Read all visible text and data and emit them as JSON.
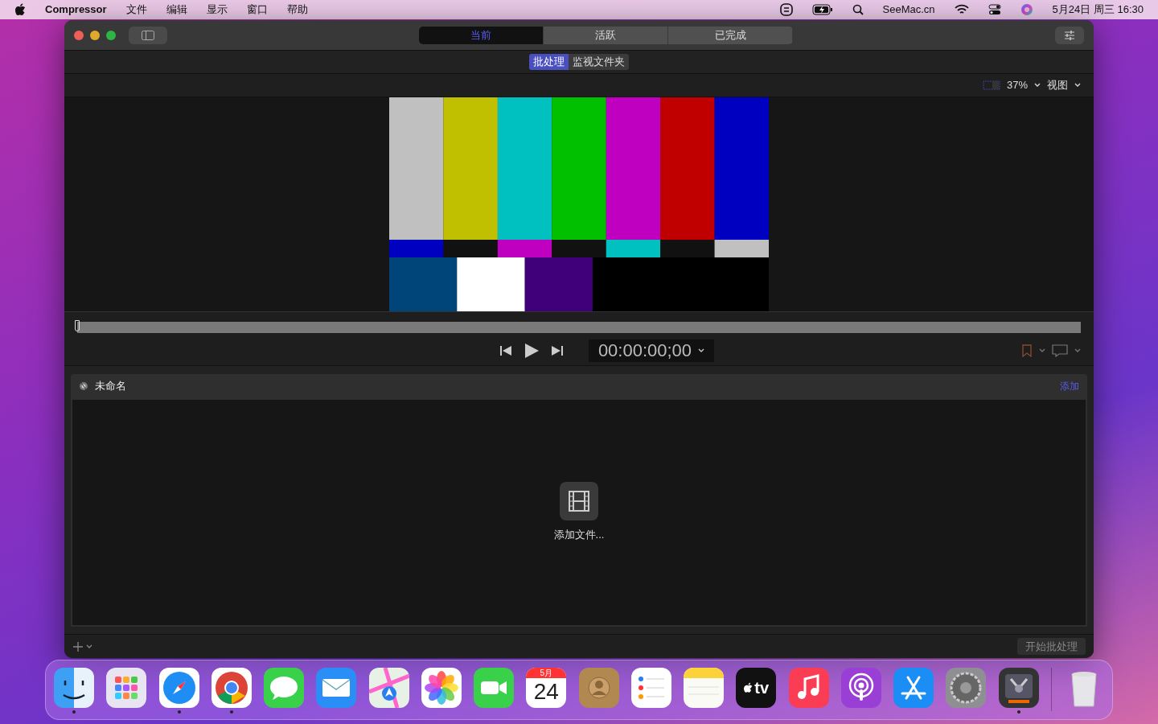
{
  "menubar": {
    "app_name": "Compressor",
    "menus": [
      "文件",
      "编辑",
      "显示",
      "窗口",
      "帮助"
    ],
    "status_text": "SeeMac.cn",
    "clock": "5月24日 周三 16:30"
  },
  "window": {
    "tabs": [
      {
        "label": "当前",
        "selected": true
      },
      {
        "label": "活跃",
        "selected": false
      },
      {
        "label": "已完成",
        "selected": false
      }
    ],
    "mode_tabs": [
      {
        "label": "批处理",
        "selected": true
      },
      {
        "label": "监视文件夹",
        "selected": false
      }
    ],
    "zoom": "37%",
    "view_menu": "视图",
    "timeline": {
      "level": 0
    },
    "timecode": "00:00:00;00",
    "batch": {
      "title": "未命名",
      "add_link": "添加",
      "empty_hint": "添加文件..."
    },
    "start_button": {
      "label": "开始批处理",
      "disabled": true
    }
  },
  "dock": {
    "items": [
      {
        "kind": "finder",
        "running": true
      },
      {
        "kind": "launchpad",
        "running": false
      },
      {
        "kind": "safari",
        "running": true
      },
      {
        "kind": "chrome",
        "running": true
      },
      {
        "kind": "messages",
        "running": false
      },
      {
        "kind": "mail",
        "running": false
      },
      {
        "kind": "maps",
        "running": false
      },
      {
        "kind": "photos",
        "running": false
      },
      {
        "kind": "facetime",
        "running": false
      },
      {
        "kind": "calendar",
        "running": false,
        "month": "5月",
        "day": "24"
      },
      {
        "kind": "contacts",
        "running": false
      },
      {
        "kind": "reminders",
        "running": false
      },
      {
        "kind": "notes",
        "running": false
      },
      {
        "kind": "tv",
        "running": false,
        "label": "tv"
      },
      {
        "kind": "music",
        "running": false
      },
      {
        "kind": "podcasts",
        "running": false
      },
      {
        "kind": "appstore",
        "running": false
      },
      {
        "kind": "settings",
        "running": false
      },
      {
        "kind": "compressor",
        "running": true
      },
      {
        "kind": "trash",
        "running": false
      }
    ]
  }
}
